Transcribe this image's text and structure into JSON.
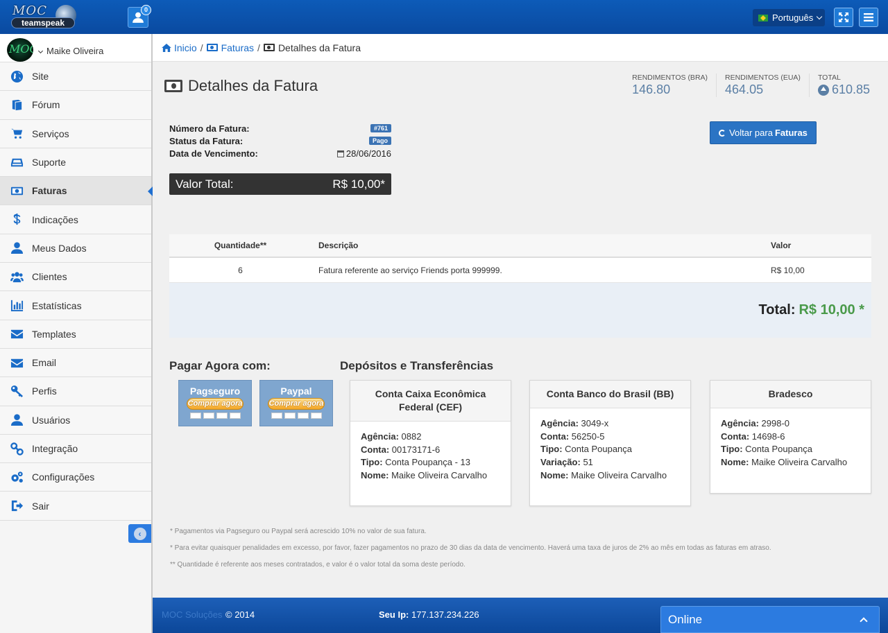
{
  "header": {
    "logo_top": "MOC",
    "logo_bottom": "teamspeak",
    "notifications_count": "0",
    "language": "Português"
  },
  "sidebar": {
    "avatar_text": "MOC",
    "user_name": "Maike Oliveira",
    "items": [
      {
        "label": "Site",
        "icon": "globe-icon"
      },
      {
        "label": "Fórum",
        "icon": "book-icon"
      },
      {
        "label": "Serviços",
        "icon": "cart-icon"
      },
      {
        "label": "Suporte",
        "icon": "hdd-icon"
      },
      {
        "label": "Faturas",
        "icon": "money-icon"
      },
      {
        "label": "Indicações",
        "icon": "dollar-icon"
      },
      {
        "label": "Meus Dados",
        "icon": "user-icon"
      },
      {
        "label": "Clientes",
        "icon": "users-icon"
      },
      {
        "label": "Estatísticas",
        "icon": "bar-chart-icon"
      },
      {
        "label": "Templates",
        "icon": "envelope-icon"
      },
      {
        "label": "Email",
        "icon": "envelope-icon"
      },
      {
        "label": "Perfis",
        "icon": "key-icon"
      },
      {
        "label": "Usuários",
        "icon": "user-icon"
      },
      {
        "label": "Integração",
        "icon": "link-icon"
      },
      {
        "label": "Configurações",
        "icon": "cogs-icon"
      },
      {
        "label": "Sair",
        "icon": "sign-out-icon"
      }
    ],
    "active_index": 4
  },
  "breadcrumb": {
    "home": "Inicio",
    "invoices": "Faturas",
    "current": "Detalhes da Fatura"
  },
  "page": {
    "title": "Detalhes da Fatura"
  },
  "stats": [
    {
      "label": "RENDIMENTOS (BRA)",
      "value": "146.80"
    },
    {
      "label": "RENDIMENTOS (EUA)",
      "value": "464.05"
    },
    {
      "label": "TOTAL",
      "value": "610.85"
    }
  ],
  "invoice": {
    "number_label": "Número da Fatura:",
    "number": "#761",
    "status_label": "Status da Fatura:",
    "status": "Pago",
    "due_label": "Data de Vencimento:",
    "due": "28/06/2016",
    "total_label": "Valor Total:",
    "total": "R$ 10,00*",
    "back_prefix": "Voltar para",
    "back_strong": "Faturas"
  },
  "table": {
    "headers": [
      "Quantidade**",
      "Descrição",
      "Valor"
    ],
    "rows": [
      {
        "qty": "6",
        "desc": "Fatura referente ao serviço Friends porta 999999.",
        "value": "R$ 10,00"
      }
    ],
    "total_label": "Total:",
    "total_value": "R$ 10,00 *"
  },
  "payment": {
    "title": "Pagar Agora com:",
    "buy_label": "Comprar agora",
    "methods": [
      "Pagseguro",
      "Paypal"
    ]
  },
  "deposits": {
    "title": "Depósitos e Transferências",
    "banks": [
      {
        "name": "Conta Caixa Econômica Federal (CEF)",
        "fields": [
          {
            "k": "Agência:",
            "v": "0882"
          },
          {
            "k": "Conta:",
            "v": "00173171-6"
          },
          {
            "k": "Tipo:",
            "v": "Conta Poupança - 13"
          },
          {
            "k": "Nome:",
            "v": "Maike Oliveira Carvalho"
          }
        ]
      },
      {
        "name": "Conta Banco do Brasil (BB)",
        "fields": [
          {
            "k": "Agência:",
            "v": "3049-x"
          },
          {
            "k": "Conta:",
            "v": "56250-5"
          },
          {
            "k": "Tipo:",
            "v": "Conta Poupança"
          },
          {
            "k": "Variação:",
            "v": "51"
          },
          {
            "k": "Nome:",
            "v": "Maike Oliveira Carvalho"
          }
        ]
      },
      {
        "name": "Bradesco",
        "fields": [
          {
            "k": "Agência:",
            "v": "2998-0"
          },
          {
            "k": "Conta:",
            "v": "14698-6"
          },
          {
            "k": "Tipo:",
            "v": "Conta Poupança"
          },
          {
            "k": "Nome:",
            "v": "Maike Oliveira Carvalho"
          }
        ]
      }
    ]
  },
  "notes": [
    "* Pagamentos via Pagseguro ou Paypal será acrescido 10% no valor de sua fatura.",
    "* Para evitar quaisquer penalidades em excesso, por favor, fazer pagamentos no prazo de 30 dias da data de vencimento. Haverá uma taxa de juros de 2% ao mês em todas as faturas em atraso.",
    "** Quantidade é referente aos meses contratados, e valor é o valor total da soma deste período."
  ],
  "footer": {
    "brand": "MOC Soluções",
    "copyright": "© 2014",
    "ip_label": "Seu Ip:",
    "ip": "177.137.234.226"
  },
  "chat": {
    "label": "Online"
  }
}
